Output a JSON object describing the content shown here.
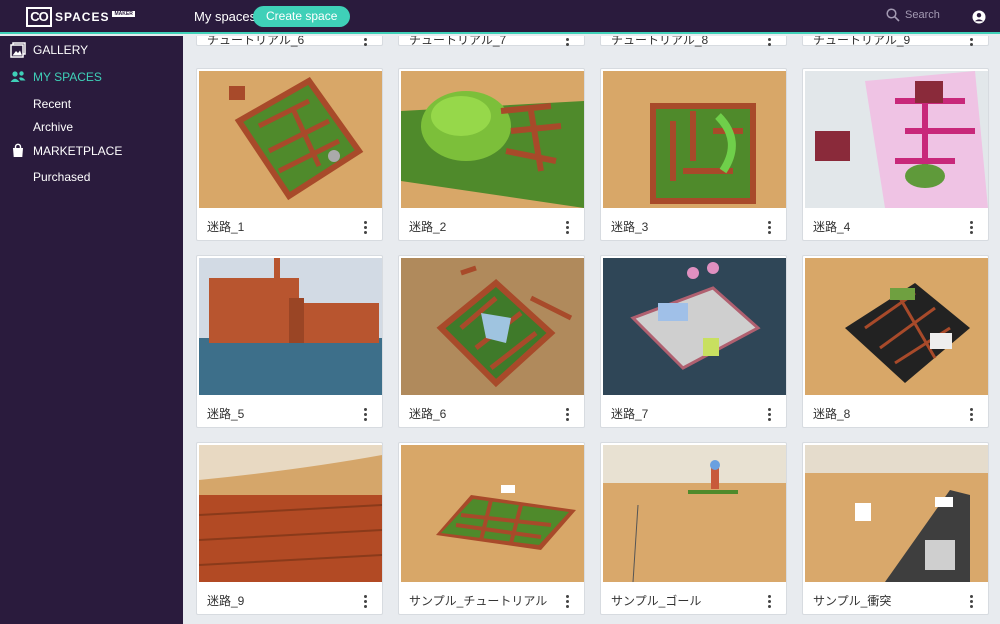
{
  "topbar": {
    "logo_box": "CO",
    "logo_text": "SPACES",
    "logo_sub": "MAKER",
    "title": "My spaces",
    "create_label": "Create space",
    "search_placeholder": "Search"
  },
  "sidebar": {
    "gallery": "GALLERY",
    "my_spaces": "MY SPACES",
    "recent": "Recent",
    "archive": "Archive",
    "marketplace": "MARKETPLACE",
    "purchased": "Purchased"
  },
  "colors": {
    "accent": "#3fd0b8",
    "nav_bg": "#2a1b3d"
  },
  "top_row": [
    "チュートリアル_6",
    "チュートリアル_7",
    "チュートリアル_8",
    "チュートリアル_9"
  ],
  "spaces": [
    "迷路_1",
    "迷路_2",
    "迷路_3",
    "迷路_4",
    "迷路_5",
    "迷路_6",
    "迷路_7",
    "迷路_8",
    "迷路_9",
    "サンプル_チュートリアル",
    "サンプル_ゴール",
    "サンプル_衝突"
  ]
}
